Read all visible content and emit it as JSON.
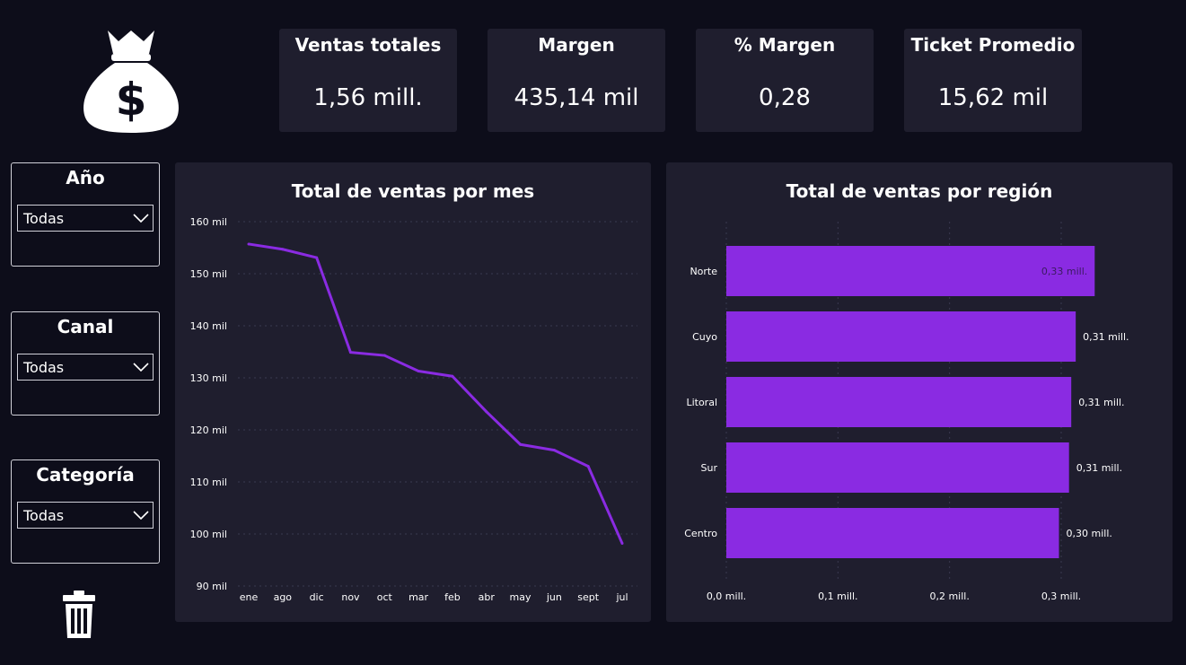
{
  "kpis": [
    {
      "title": "Ventas totales",
      "value": "1,56 mill."
    },
    {
      "title": "Margen",
      "value": "435,14 mil"
    },
    {
      "title": "% Margen",
      "value": "0,28"
    },
    {
      "title": "Ticket Promedio",
      "value": "15,62 mil"
    }
  ],
  "slicers": [
    {
      "title": "Año",
      "value": "Todas"
    },
    {
      "title": "Canal",
      "value": "Todas"
    },
    {
      "title": "Categoría",
      "value": "Todas"
    }
  ],
  "icons": {
    "logo": "money-bag-icon",
    "clear": "trash-icon"
  },
  "colors": {
    "background": "#0d0d1a",
    "panel": "#1f1e2e",
    "accent": "#8a2be2"
  },
  "chart_data": [
    {
      "type": "line",
      "title": "Total de ventas por mes",
      "x": [
        "ene",
        "ago",
        "dic",
        "nov",
        "oct",
        "mar",
        "feb",
        "abr",
        "may",
        "jun",
        "sept",
        "jul"
      ],
      "values": [
        155700,
        154700,
        153100,
        134900,
        134300,
        131300,
        130300,
        123500,
        117200,
        116100,
        113000,
        98200
      ],
      "ylim": [
        90000,
        160000
      ],
      "yticks": [
        160000,
        150000,
        140000,
        130000,
        120000,
        110000,
        100000,
        90000
      ],
      "ytick_labels": [
        "160 mil",
        "150 mil",
        "140 mil",
        "130 mil",
        "120 mil",
        "110 mil",
        "100 mil",
        "90 mil"
      ],
      "grid": true
    },
    {
      "type": "bar",
      "orientation": "horizontal",
      "title": "Total de ventas por región",
      "categories": [
        "Norte",
        "Cuyo",
        "Litoral",
        "Sur",
        "Centro"
      ],
      "values": [
        0.33,
        0.313,
        0.309,
        0.307,
        0.298
      ],
      "data_labels": [
        "0,33 mill.",
        "0,31 mill.",
        "0,31 mill.",
        "0,31 mill.",
        "0,30 mill."
      ],
      "xlim": [
        0,
        0.3
      ],
      "xticks": [
        0,
        0.1,
        0.2,
        0.3
      ],
      "xtick_labels": [
        "0,0 mill.",
        "0,1 mill.",
        "0,2 mill.",
        "0,3 mill."
      ],
      "grid": true
    }
  ]
}
